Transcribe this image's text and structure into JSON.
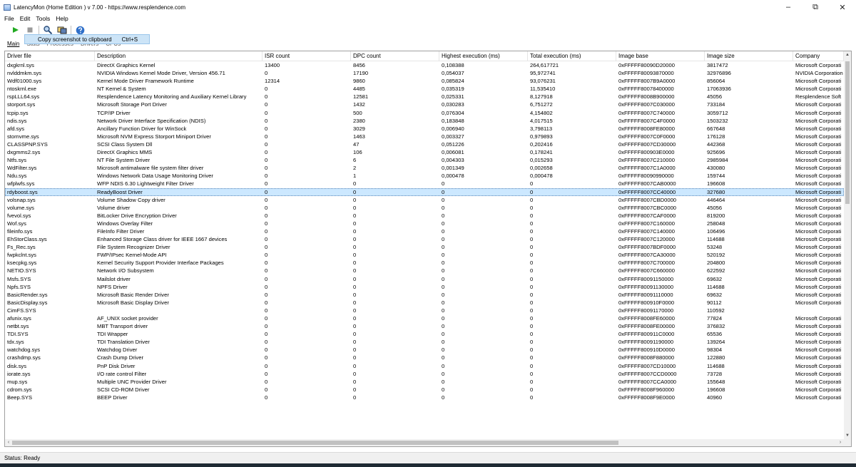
{
  "window": {
    "title": "LatencyMon (Home Edition ) v 7.00 - https://www.resplendence.com",
    "minimize": "–",
    "maximize": "⧉",
    "close": "✕"
  },
  "menu": [
    "File",
    "Edit",
    "Tools",
    "Help"
  ],
  "toolbar": {
    "play_icon": "play-icon",
    "stop_icon": "stop-icon",
    "search_icon": "search-icon",
    "screenshot_icon": "screenshot-icon",
    "help_icon": "help-icon"
  },
  "tooltip": {
    "label": "Copy screenshot to clipboard",
    "shortcut": "Ctrl+S"
  },
  "tabs": [
    "Main",
    "Stats",
    "Processes",
    "Drivers",
    "CPUs"
  ],
  "columns": [
    "Driver file",
    "Description",
    "ISR count",
    "DPC count",
    "Highest execution (ms)",
    "Total execution (ms)",
    "Image base",
    "Image size",
    "Company"
  ],
  "selected_row": 20,
  "rows": [
    [
      "dxgkrnl.sys",
      "DirectX Graphics Kernel",
      "13400",
      "8456",
      "0,108388",
      "264,617721",
      "0xFFFFF80090D20000",
      "3817472",
      "Microsoft Corporati"
    ],
    [
      "nvlddmkm.sys",
      "NVIDIA Windows Kernel Mode Driver, Version 456.71",
      "0",
      "17190",
      "0,054037",
      "95,972741",
      "0xFFFFF80093870000",
      "32976896",
      "NVIDIA Corporation"
    ],
    [
      "Wdf01000.sys",
      "Kernel Mode Driver Framework Runtime",
      "12314",
      "9860",
      "0,085824",
      "93,076231",
      "0xFFFFF8007B9A0000",
      "856064",
      "Microsoft Corporati"
    ],
    [
      "ntoskrnl.exe",
      "NT Kernel & System",
      "0",
      "4485",
      "0,035319",
      "11,535410",
      "0xFFFFF80078400000",
      "17063936",
      "Microsoft Corporati"
    ],
    [
      "rspLLL64.sys",
      "Resplendence Latency Monitoring and Auxiliary Kernel Library",
      "0",
      "12581",
      "0,025331",
      "8,127918",
      "0xFFFFF8008B900000",
      "45056",
      "Resplendence Soft"
    ],
    [
      "storport.sys",
      "Microsoft Storage Port Driver",
      "0",
      "1432",
      "0,030283",
      "6,751272",
      "0xFFFFF8007C030000",
      "733184",
      "Microsoft Corporati"
    ],
    [
      "tcpip.sys",
      "TCP/IP Driver",
      "0",
      "500",
      "0,076304",
      "4,154802",
      "0xFFFFF8007C740000",
      "3059712",
      "Microsoft Corporati"
    ],
    [
      "ndis.sys",
      "Network Driver Interface Specification (NDIS)",
      "0",
      "2380",
      "0,183848",
      "4,017515",
      "0xFFFFF8007C4F0000",
      "1503232",
      "Microsoft Corporati"
    ],
    [
      "afd.sys",
      "Ancillary Function Driver for WinSock",
      "0",
      "3029",
      "0,006940",
      "3,798113",
      "0xFFFFF8008FE80000",
      "667648",
      "Microsoft Corporati"
    ],
    [
      "stornvme.sys",
      "Microsoft NVM Express Storport Miniport Driver",
      "0",
      "1463",
      "0,003327",
      "0,979893",
      "0xFFFFF8007C0F0000",
      "176128",
      "Microsoft Corporati"
    ],
    [
      "CLASSPNP.SYS",
      "SCSI Class System Dll",
      "0",
      "47",
      "0,051226",
      "0,202416",
      "0xFFFFF8007CD30000",
      "442368",
      "Microsoft Corporati"
    ],
    [
      "dxgmms2.sys",
      "DirectX Graphics MMS",
      "0",
      "106",
      "0,006081",
      "0,178241",
      "0xFFFFF800903E0000",
      "925696",
      "Microsoft Corporati"
    ],
    [
      "Ntfs.sys",
      "NT File System Driver",
      "0",
      "6",
      "0,004303",
      "0,015293",
      "0xFFFFF8007C210000",
      "2985984",
      "Microsoft Corporati"
    ],
    [
      "WdFilter.sys",
      "Microsoft antimalware file system filter driver",
      "0",
      "2",
      "0,001349",
      "0,002658",
      "0xFFFFF8007C1A0000",
      "430080",
      "Microsoft Corporati"
    ],
    [
      "Ndu.sys",
      "Windows Network Data Usage Monitoring Driver",
      "0",
      "1",
      "0,000478",
      "0,000478",
      "0xFFFFF80090990000",
      "159744",
      "Microsoft Corporati"
    ],
    [
      "wfplwfs.sys",
      "WFP NDIS 6.30 Lightweight Filter Driver",
      "0",
      "0",
      "0",
      "0",
      "0xFFFFF8007CAB0000",
      "196608",
      "Microsoft Corporati"
    ],
    [
      "rdyboost.sys",
      "ReadyBoost Driver",
      "0",
      "0",
      "0",
      "0",
      "0xFFFFF8007CC40000",
      "327680",
      "Microsoft Corporati"
    ],
    [
      "volsnap.sys",
      "Volume Shadow Copy driver",
      "0",
      "0",
      "0",
      "0",
      "0xFFFFF8007CBD0000",
      "446464",
      "Microsoft Corporati"
    ],
    [
      "volume.sys",
      "Volume driver",
      "0",
      "0",
      "0",
      "0",
      "0xFFFFF8007CBC0000",
      "45056",
      "Microsoft Corporati"
    ],
    [
      "fvevol.sys",
      "BitLocker Drive Encryption Driver",
      "0",
      "0",
      "0",
      "0",
      "0xFFFFF8007CAF0000",
      "819200",
      "Microsoft Corporati"
    ],
    [
      "Wof.sys",
      "Windows Overlay Filter",
      "0",
      "0",
      "0",
      "0",
      "0xFFFFF8007C160000",
      "258048",
      "Microsoft Corporati"
    ],
    [
      "fileinfo.sys",
      "FileInfo Filter Driver",
      "0",
      "0",
      "0",
      "0",
      "0xFFFFF8007C140000",
      "106496",
      "Microsoft Corporati"
    ],
    [
      "EhStorClass.sys",
      "Enhanced Storage Class driver for IEEE 1667 devices",
      "0",
      "0",
      "0",
      "0",
      "0xFFFFF8007C120000",
      "114688",
      "Microsoft Corporati"
    ],
    [
      "Fs_Rec.sys",
      "File System Recognizer Driver",
      "0",
      "0",
      "0",
      "0",
      "0xFFFFF8007BDF0000",
      "53248",
      "Microsoft Corporati"
    ],
    [
      "fwpkclnt.sys",
      "FWP/IPsec Kernel-Mode API",
      "0",
      "0",
      "0",
      "0",
      "0xFFFFF8007CA30000",
      "520192",
      "Microsoft Corporati"
    ],
    [
      "ksecpkg.sys",
      "Kernel Security Support Provider Interface Packages",
      "0",
      "0",
      "0",
      "0",
      "0xFFFFF8007C700000",
      "204800",
      "Microsoft Corporati"
    ],
    [
      "NETIO.SYS",
      "Network I/O Subsystem",
      "0",
      "0",
      "0",
      "0",
      "0xFFFFF8007C660000",
      "622592",
      "Microsoft Corporati"
    ],
    [
      "Msfs.SYS",
      "Mailslot driver",
      "0",
      "0",
      "0",
      "0",
      "0xFFFFF80091150000",
      "69632",
      "Microsoft Corporati"
    ],
    [
      "Npfs.SYS",
      "NPFS Driver",
      "0",
      "0",
      "0",
      "0",
      "0xFFFFF80091130000",
      "114688",
      "Microsoft Corporati"
    ],
    [
      "BasicRender.sys",
      "Microsoft Basic Render Driver",
      "0",
      "0",
      "0",
      "0",
      "0xFFFFF80091110000",
      "69632",
      "Microsoft Corporati"
    ],
    [
      "BasicDisplay.sys",
      "Microsoft Basic Display Driver",
      "0",
      "0",
      "0",
      "0",
      "0xFFFFF800910F0000",
      "90112",
      "Microsoft Corporati"
    ],
    [
      "CimFS.SYS",
      "",
      "0",
      "0",
      "0",
      "0",
      "0xFFFFF80091170000",
      "110592",
      ""
    ],
    [
      "afunix.sys",
      "AF_UNIX socket provider",
      "0",
      "0",
      "0",
      "0",
      "0xFFFFF8008FE60000",
      "77824",
      "Microsoft Corporati"
    ],
    [
      "netbt.sys",
      "MBT Transport driver",
      "0",
      "0",
      "0",
      "0",
      "0xFFFFF8008FE00000",
      "376832",
      "Microsoft Corporati"
    ],
    [
      "TDI.SYS",
      "TDI Wrapper",
      "0",
      "0",
      "0",
      "0",
      "0xFFFFF800911C0000",
      "65536",
      "Microsoft Corporati"
    ],
    [
      "tdx.sys",
      "TDI Translation Driver",
      "0",
      "0",
      "0",
      "0",
      "0xFFFFF80091190000",
      "139264",
      "Microsoft Corporati"
    ],
    [
      "watchdog.sys",
      "Watchdog Driver",
      "0",
      "0",
      "0",
      "0",
      "0xFFFFF800910D0000",
      "98304",
      "Microsoft Corporati"
    ],
    [
      "crashdmp.sys",
      "Crash Dump Driver",
      "0",
      "0",
      "0",
      "0",
      "0xFFFFF8008F880000",
      "122880",
      "Microsoft Corporati"
    ],
    [
      "disk.sys",
      "PnP Disk Driver",
      "0",
      "0",
      "0",
      "0",
      "0xFFFFF8007CD10000",
      "114688",
      "Microsoft Corporati"
    ],
    [
      "iorate.sys",
      "I/O rate control Filter",
      "0",
      "0",
      "0",
      "0",
      "0xFFFFF8007CCD0000",
      "73728",
      "Microsoft Corporati"
    ],
    [
      "mup.sys",
      "Multiple UNC Provider Driver",
      "0",
      "0",
      "0",
      "0",
      "0xFFFFF8007CCA0000",
      "155648",
      "Microsoft Corporati"
    ],
    [
      "cdrom.sys",
      "SCSI CD-ROM Driver",
      "0",
      "0",
      "0",
      "0",
      "0xFFFFF8008F960000",
      "196608",
      "Microsoft Corporati"
    ],
    [
      "Beep.SYS",
      "BEEP Driver",
      "0",
      "0",
      "0",
      "0",
      "0xFFFFF8008F9E0000",
      "40960",
      "Microsoft Corporati"
    ]
  ],
  "status": "Status: Ready",
  "colors": {
    "selection": "#cce8ff",
    "tooltip": "#cce4f7",
    "play": "#22aa22"
  }
}
